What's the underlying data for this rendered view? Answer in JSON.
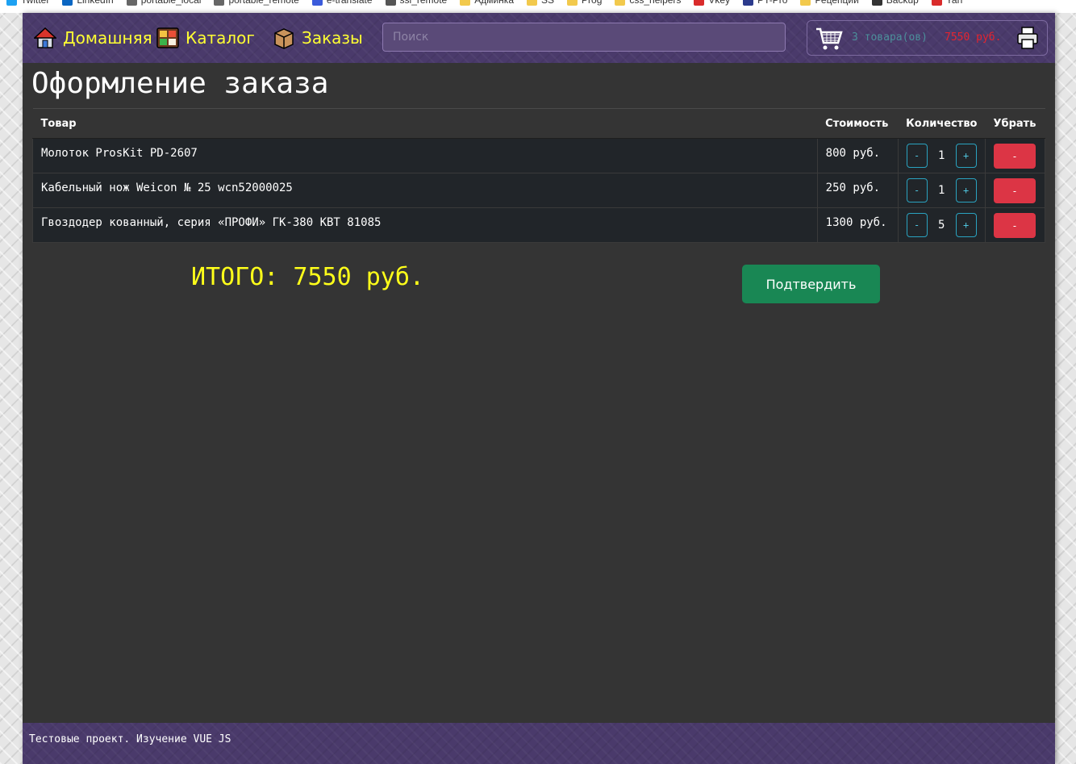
{
  "bookmarks": [
    {
      "label": "Twitter",
      "color": "#1da1f2"
    },
    {
      "label": "LinkedIn",
      "color": "#0a66c2"
    },
    {
      "label": "portable_local",
      "color": "#666666"
    },
    {
      "label": "portable_remote",
      "color": "#666666"
    },
    {
      "label": "e-translate",
      "color": "#3b5bdb"
    },
    {
      "label": "ssl_remote",
      "color": "#555555"
    },
    {
      "label": "Админка",
      "color": "#f2c94c"
    },
    {
      "label": "SS",
      "color": "#f2c94c"
    },
    {
      "label": "Prog",
      "color": "#f2c94c"
    },
    {
      "label": "css_helpers",
      "color": "#f2c94c"
    },
    {
      "label": "Vkey",
      "color": "#d92b2b"
    },
    {
      "label": "PT-Pro",
      "color": "#2b3a8c"
    },
    {
      "label": "Рецепции",
      "color": "#f2c94c"
    },
    {
      "label": "Backup",
      "color": "#333333"
    },
    {
      "label": "Yan",
      "color": "#d92b2b"
    }
  ],
  "nav": {
    "home": "Домашняя",
    "catalog": "Каталог",
    "orders": "Заказы",
    "search_placeholder": "Поиск",
    "cart_count": "3 товара(ов)",
    "cart_total": "7550 руб."
  },
  "page": {
    "title": "Оформление заказа",
    "columns": [
      "Товар",
      "Стоимость",
      "Количество",
      "Убрать"
    ],
    "rows": [
      {
        "name": "Молоток ProsKit PD-2607",
        "price": "800 руб.",
        "qty": "1"
      },
      {
        "name": "Кабельный нож Weicon № 25 wcn52000025",
        "price": "250 руб.",
        "qty": "1"
      },
      {
        "name": "Гвоздодер кованный, серия «ПРОФИ» ГК-380 КВТ 81085",
        "price": "1300 руб.",
        "qty": "5"
      }
    ],
    "minus": "-",
    "plus": "+",
    "remove": "-",
    "total": "ИТОГО: 7550 руб.",
    "confirm": "Подтвердить"
  },
  "footer": {
    "text": "Тестовые проект. Изучение VUE JS"
  },
  "colors": {
    "navbar": "#4a3a6b",
    "nav_link": "#ffff33",
    "cart_count": "#4c8f9b",
    "cart_total": "#e5242f",
    "total_text": "#ffff1a",
    "confirm": "#198754",
    "remove": "#dc3545",
    "qty_btn": "#2aa3c0"
  }
}
